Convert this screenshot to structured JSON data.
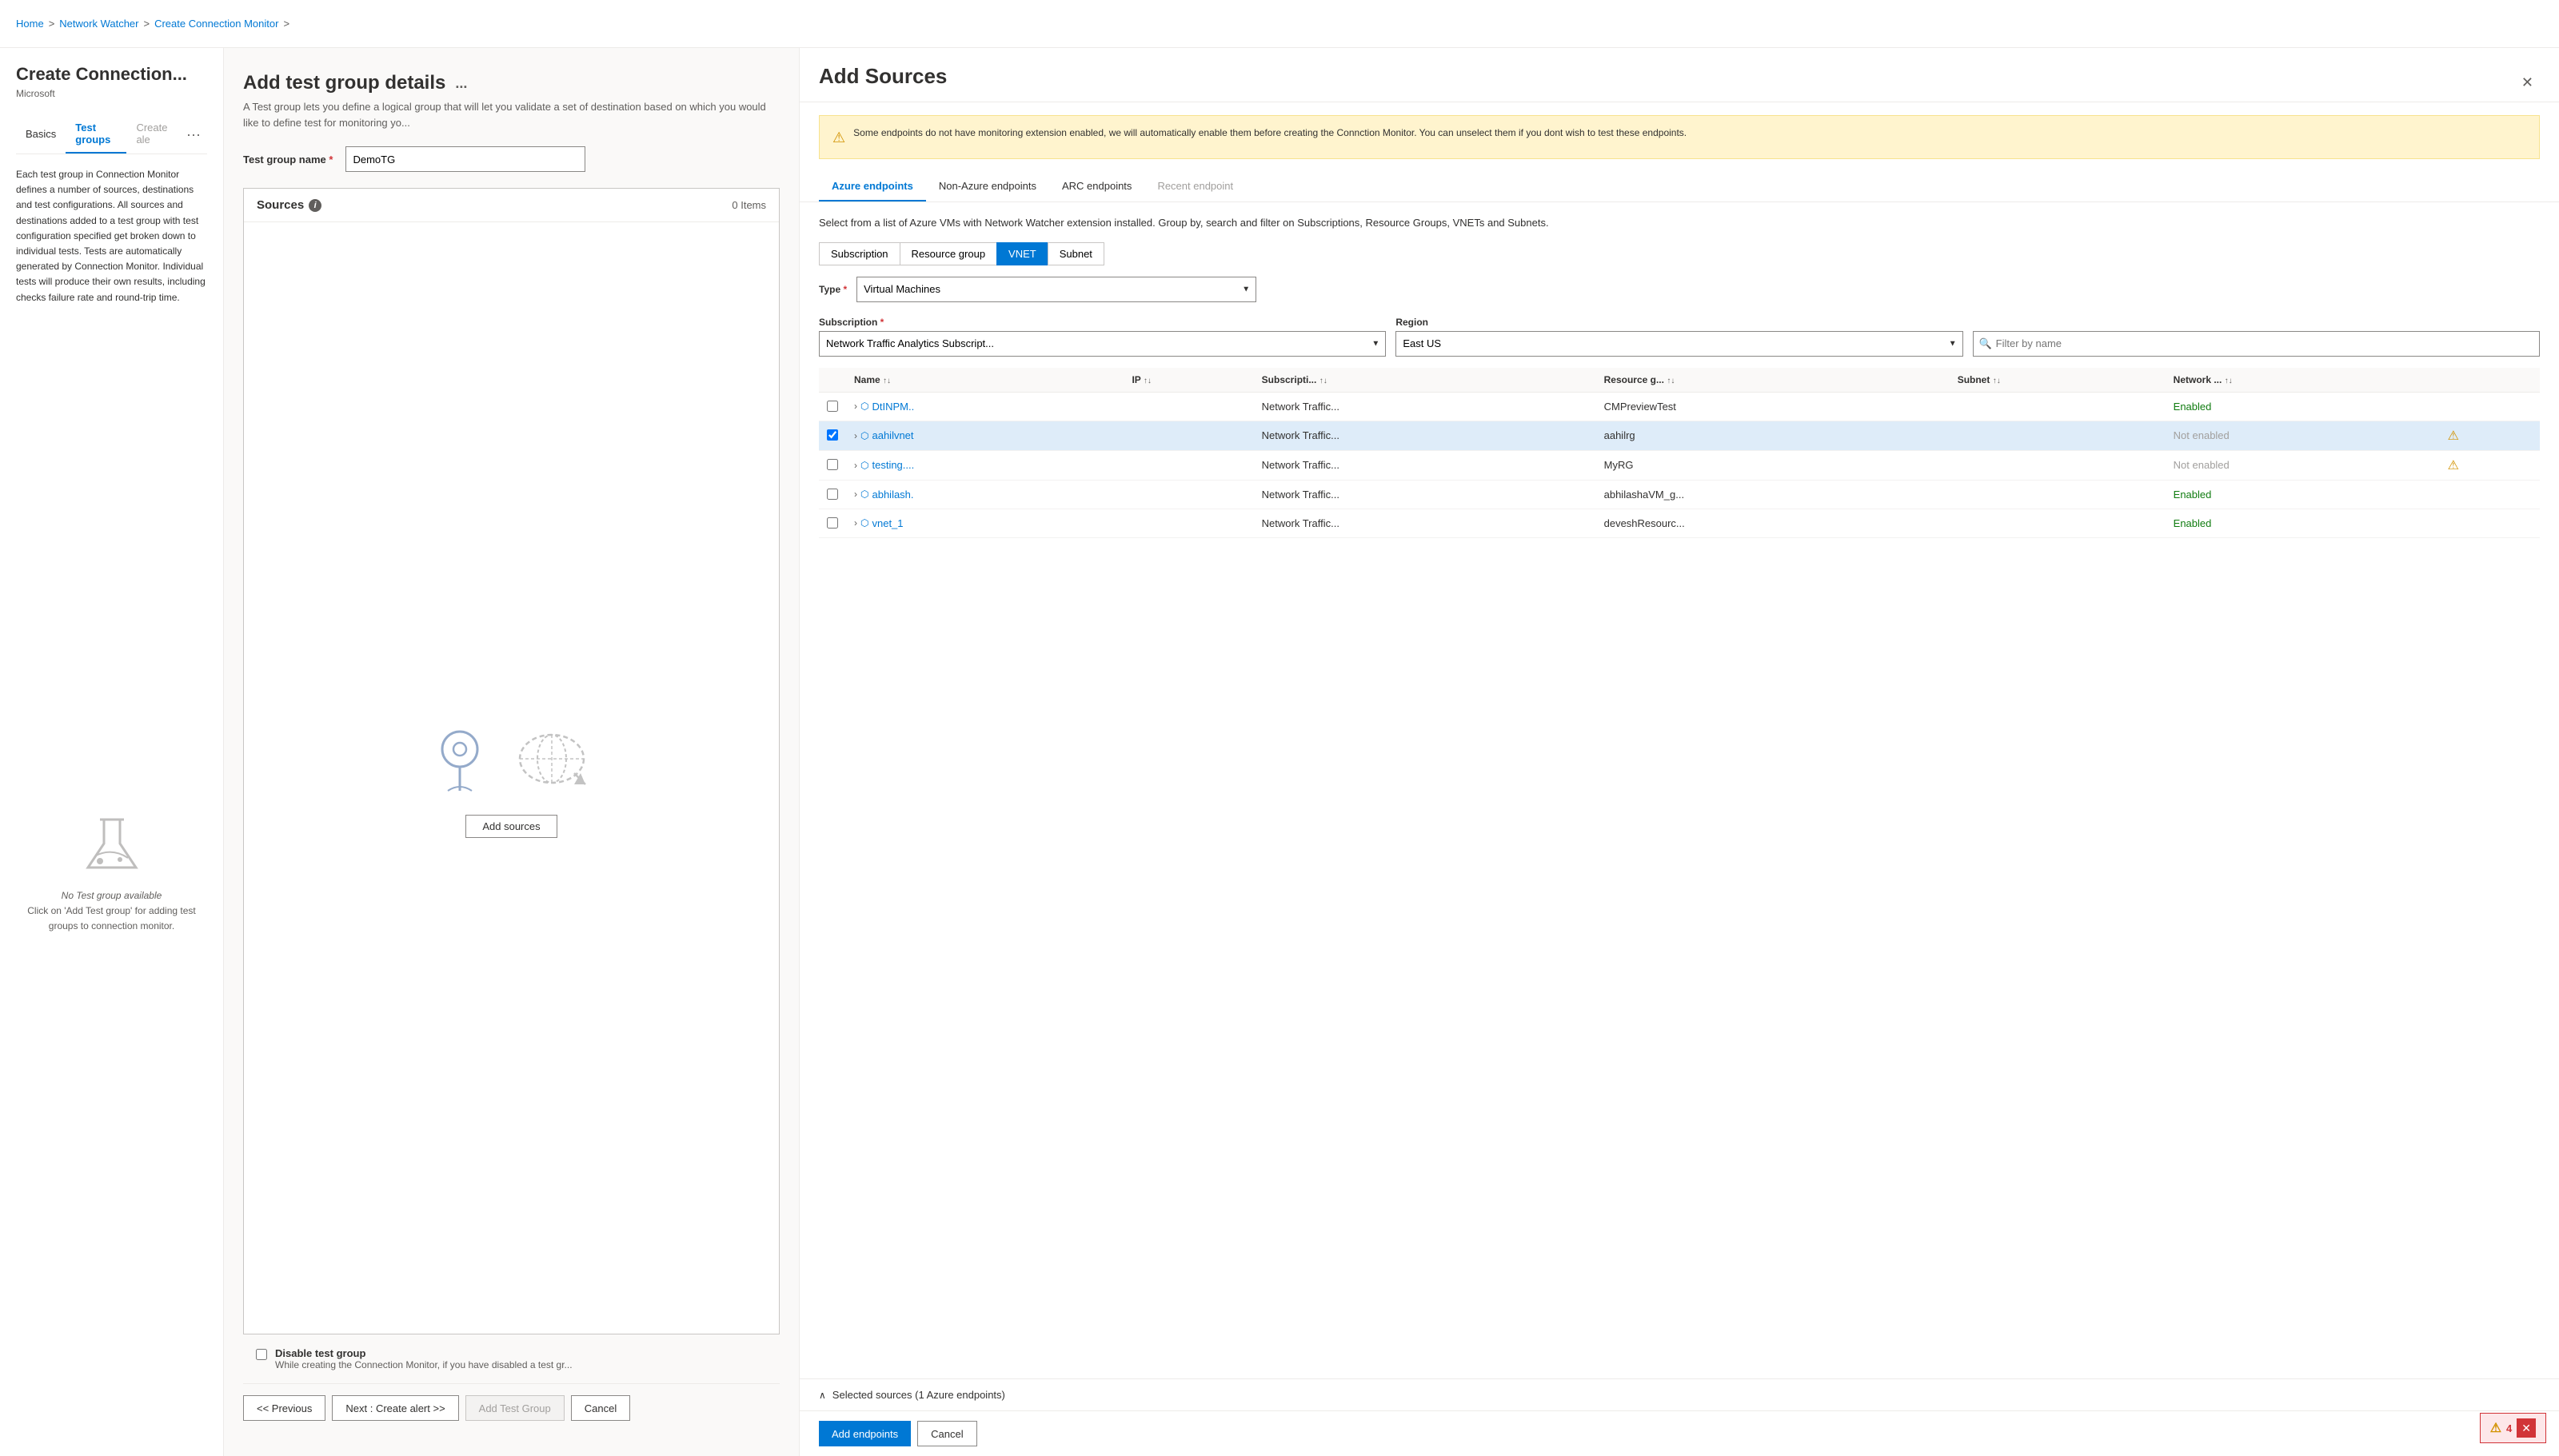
{
  "breadcrumb": {
    "home": "Home",
    "network_watcher": "Network Watcher",
    "create_connection_monitor": "Create Connection Monitor",
    "sep": ">"
  },
  "page_title": "Create Connection...",
  "page_subtitle": "Microsoft",
  "sidebar": {
    "tabs": [
      {
        "label": "Basics",
        "active": false
      },
      {
        "label": "Test groups",
        "active": true
      },
      {
        "label": "Create ale",
        "active": false,
        "disabled": true
      }
    ],
    "more_label": "...",
    "description": "Each test group in Connection Monitor defines a number of sources, destinations and test configurations. All sources and destinations added to a test group with test configuration specified get broken down to individual tests. Tests are automatically generated by Connection Monitor. Individual tests will produce their own results, including checks failure rate and round-trip time.",
    "empty_text1": "No Test group available",
    "empty_text2": "Click on 'Add Test group' for adding test groups to connection monitor."
  },
  "middle_panel": {
    "title": "Add test group details",
    "more_label": "...",
    "desc": "A Test group lets you define a logical group that will let you validate a set of destination based on which you would like to define test for monitoring yo...",
    "test_group_name_label": "Test group name",
    "test_group_name_req": "*",
    "test_group_name_value": "DemoTG",
    "sources_label": "Sources",
    "sources_count": "0 Items",
    "add_sources_btn": "Add sources",
    "disable_label": "Disable test group",
    "disable_desc": "While creating the Connection Monitor, if you have disabled a test gr..."
  },
  "bottom_bar": {
    "previous_label": "<< Previous",
    "next_label": "Next : Create alert >>",
    "add_test_group_label": "Add Test Group",
    "cancel_label": "Cancel"
  },
  "right_panel": {
    "title": "Add Sources",
    "close_label": "✕",
    "warning_text": "Some endpoints do not have monitoring extension enabled, we will automatically enable them before creating the Connction Monitor. You can unselect them if you dont wish to test these endpoints.",
    "tabs": [
      {
        "label": "Azure endpoints",
        "active": true
      },
      {
        "label": "Non-Azure endpoints",
        "active": false
      },
      {
        "label": "ARC endpoints",
        "active": false
      },
      {
        "label": "Recent endpoint",
        "active": false,
        "disabled": true
      }
    ],
    "select_desc": "Select from a list of Azure VMs with Network Watcher extension installed. Group by, search and filter on Subscriptions, Resource Groups, VNETs and Subnets.",
    "filter_buttons": [
      {
        "label": "Subscription",
        "active": false
      },
      {
        "label": "Resource group",
        "active": false
      },
      {
        "label": "VNET",
        "active": true
      },
      {
        "label": "Subnet",
        "active": false
      }
    ],
    "type_label": "Type",
    "type_req": "*",
    "type_value": "Virtual Machines",
    "subscription_label": "Subscription",
    "subscription_req": "*",
    "subscription_value": "Network Traffic Analytics Subscript...",
    "region_label": "Region",
    "region_value": "East US",
    "filter_placeholder": "Filter by name",
    "table": {
      "columns": [
        {
          "label": "Name",
          "sort": true
        },
        {
          "label": "IP",
          "sort": true
        },
        {
          "label": "Subscripti...",
          "sort": true
        },
        {
          "label": "Resource g...",
          "sort": true
        },
        {
          "label": "Subnet",
          "sort": true
        },
        {
          "label": "Network ...",
          "sort": true
        }
      ],
      "rows": [
        {
          "selected": false,
          "expand": true,
          "name": "DtINPM..",
          "ip": "",
          "subscription": "Network Traffic...",
          "resource_group": "CMPreviewTest",
          "subnet": "",
          "network": "Enabled",
          "warning": false
        },
        {
          "selected": true,
          "expand": true,
          "name": "aahilvnet",
          "ip": "",
          "subscription": "Network Traffic...",
          "resource_group": "aahilrg",
          "subnet": "",
          "network": "Not enabled",
          "warning": true
        },
        {
          "selected": false,
          "expand": true,
          "name": "testing....",
          "ip": "",
          "subscription": "Network Traffic...",
          "resource_group": "MyRG",
          "subnet": "",
          "network": "Not enabled",
          "warning": true
        },
        {
          "selected": false,
          "expand": true,
          "name": "abhilash.",
          "ip": "",
          "subscription": "Network Traffic...",
          "resource_group": "abhilashaVM_g...",
          "subnet": "",
          "network": "Enabled",
          "warning": false
        },
        {
          "selected": false,
          "expand": true,
          "name": "vnet_1",
          "ip": "",
          "subscription": "Network Traffic...",
          "resource_group": "deveshResourc...",
          "subnet": "",
          "network": "Enabled",
          "warning": false
        }
      ]
    },
    "selected_sources_label": "Selected sources (1 Azure endpoints)",
    "add_endpoints_btn": "Add endpoints",
    "cancel_btn": "Cancel"
  },
  "error_badge": {
    "warn": "⚠",
    "count": "4",
    "close": "✕"
  }
}
